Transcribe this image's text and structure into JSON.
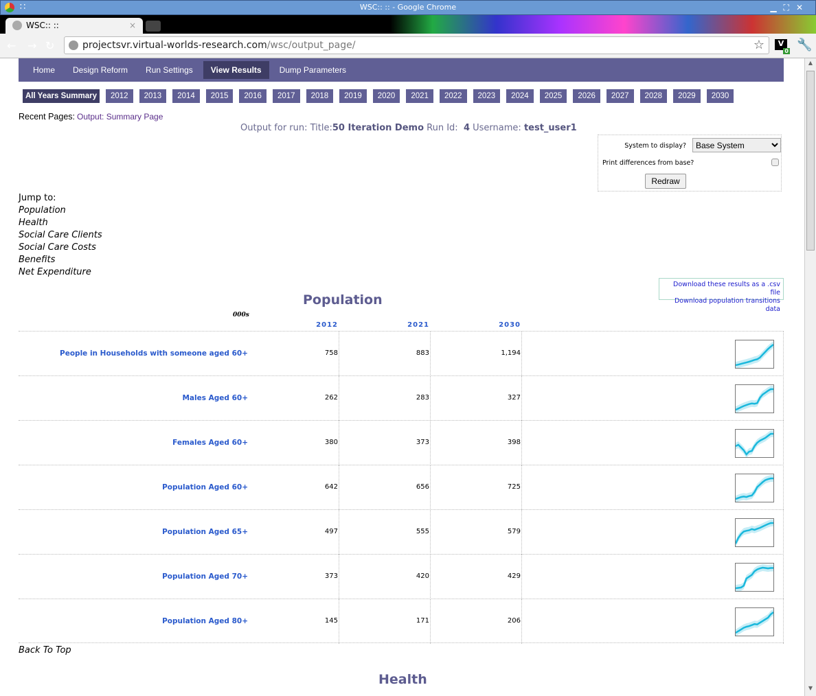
{
  "window": {
    "title": "WSC::  :: - Google Chrome"
  },
  "browser": {
    "tab_title": "WSC::  ::",
    "url_host": "projectsvr.virtual-worlds-research.com",
    "url_path": "/wsc/output_page/",
    "extension_badge": "0"
  },
  "nav": {
    "items": [
      {
        "label": "Home"
      },
      {
        "label": "Design Reform"
      },
      {
        "label": "Run Settings"
      },
      {
        "label": "View Results",
        "active": true
      },
      {
        "label": "Dump Parameters"
      }
    ]
  },
  "years": {
    "items": [
      "All Years Summary",
      "2012",
      "2013",
      "2014",
      "2015",
      "2016",
      "2017",
      "2018",
      "2019",
      "2020",
      "2021",
      "2022",
      "2023",
      "2024",
      "2025",
      "2026",
      "2027",
      "2028",
      "2029",
      "2030"
    ]
  },
  "recent": {
    "label": "Recent Pages:",
    "link": "Output: Summary Page"
  },
  "run": {
    "prefix": "Output for run: Title:",
    "title": "50 Iteration Demo",
    "runid_label": "Run Id:",
    "runid": "4",
    "user_label": "Username:",
    "user": "test_user1"
  },
  "options": {
    "system_label": "System to display?",
    "system_value": "Base System",
    "diff_label": "Print differences from base?",
    "diff_checked": false,
    "redraw": "Redraw"
  },
  "jump": {
    "label": "Jump to:",
    "links": [
      "Population",
      "Health",
      "Social Care Clients",
      "Social Care Costs",
      "Benefits",
      "Net Expenditure"
    ]
  },
  "downloads": {
    "csv": "Download these results as a .csv file",
    "transitions": "Download population transitions data"
  },
  "population": {
    "title": "Population",
    "units": "000s",
    "columns": [
      "2012",
      "2021",
      "2030"
    ],
    "sparkline_color": "#1ab8dc",
    "rows": [
      {
        "label": "People in Households with someone aged 60+",
        "values": [
          "758",
          "883",
          "1,194"
        ],
        "trend": [
          758,
          770,
          785,
          800,
          815,
          830,
          850,
          870,
          883,
          920,
          980,
          1040,
          1100,
          1150,
          1194
        ]
      },
      {
        "label": "Males Aged 60+",
        "values": [
          "262",
          "283",
          "327"
        ],
        "trend": [
          262,
          266,
          270,
          274,
          277,
          280,
          282,
          281,
          283,
          300,
          310,
          316,
          322,
          327,
          327
        ]
      },
      {
        "label": "Females Aged 60+",
        "values": [
          "380",
          "373",
          "398"
        ],
        "trend": [
          380,
          382,
          378,
          374,
          368,
          372,
          373,
          380,
          385,
          388,
          390,
          392,
          395,
          398,
          398
        ]
      },
      {
        "label": "Population Aged 60+",
        "values": [
          "642",
          "656",
          "725"
        ],
        "trend": [
          642,
          646,
          650,
          652,
          650,
          654,
          656,
          670,
          690,
          700,
          710,
          718,
          722,
          725,
          725
        ]
      },
      {
        "label": "Population Aged 65+",
        "values": [
          "497",
          "555",
          "579"
        ],
        "trend": [
          497,
          520,
          535,
          545,
          548,
          550,
          555,
          552,
          556,
          560,
          565,
          570,
          575,
          579,
          579
        ]
      },
      {
        "label": "Population Aged 70+",
        "values": [
          "373",
          "420",
          "429"
        ],
        "trend": [
          373,
          374,
          375,
          380,
          400,
          405,
          410,
          420,
          425,
          428,
          430,
          429,
          428,
          429,
          429
        ]
      },
      {
        "label": "Population Aged 80+",
        "values": [
          "145",
          "171",
          "206"
        ],
        "trend": [
          145,
          150,
          155,
          160,
          163,
          165,
          168,
          171,
          170,
          175,
          180,
          185,
          190,
          200,
          206
        ]
      }
    ]
  },
  "back_to_top": "Back To Top",
  "health": {
    "title": "Health"
  }
}
